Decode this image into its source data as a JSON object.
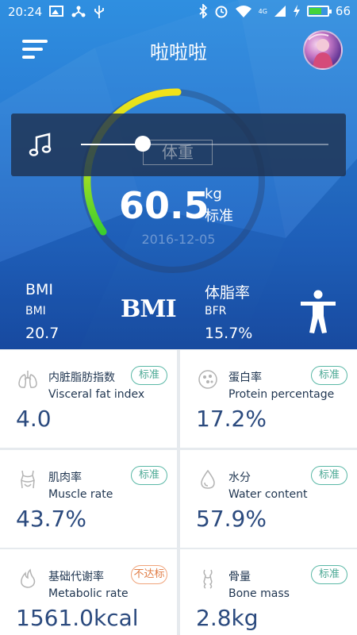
{
  "status_bar": {
    "time": "20:24",
    "battery": "66",
    "battery_level": 0.66,
    "network": "4G"
  },
  "header": {
    "title": "啦啦啦"
  },
  "gauge": {
    "value": "60.5",
    "unit": "kg",
    "status": "标准",
    "date": "2016-12-05"
  },
  "music": {
    "tag": "体重",
    "progress": 0.25
  },
  "stats": {
    "bmi": {
      "label": "BMI",
      "sub": "BMI",
      "value": "20.7"
    },
    "bmi_logo": "BMI",
    "bfr": {
      "label": "体脂率",
      "sub": "BFR",
      "value": "15.7%"
    }
  },
  "cards": [
    {
      "cn": "内脏脂肪指数",
      "en": "Visceral fat index",
      "value": "4.0",
      "badge": "标准",
      "icon": "lungs-icon",
      "warn": false
    },
    {
      "cn": "蛋白率",
      "en": "Protein percentage",
      "value": "17.2%",
      "badge": "标准",
      "icon": "cell-icon",
      "warn": false
    },
    {
      "cn": "肌肉率",
      "en": "Muscle rate",
      "value": "43.7%",
      "badge": "标准",
      "icon": "body-icon",
      "warn": false
    },
    {
      "cn": "水分",
      "en": "Water content",
      "value": "57.9%",
      "badge": "标准",
      "icon": "water-drop-icon",
      "warn": false
    },
    {
      "cn": "基础代谢率",
      "en": "Metabolic rate",
      "value": "1561.0kcal",
      "badge": "不达标",
      "icon": "flame-icon",
      "warn": true
    },
    {
      "cn": "骨量",
      "en": "Bone mass",
      "value": "2.8kg",
      "badge": "标准",
      "icon": "bone-icon",
      "warn": false
    }
  ],
  "colors": {
    "ok": "#4aa894",
    "warn": "#e07c45",
    "value": "#2b4a7e"
  }
}
